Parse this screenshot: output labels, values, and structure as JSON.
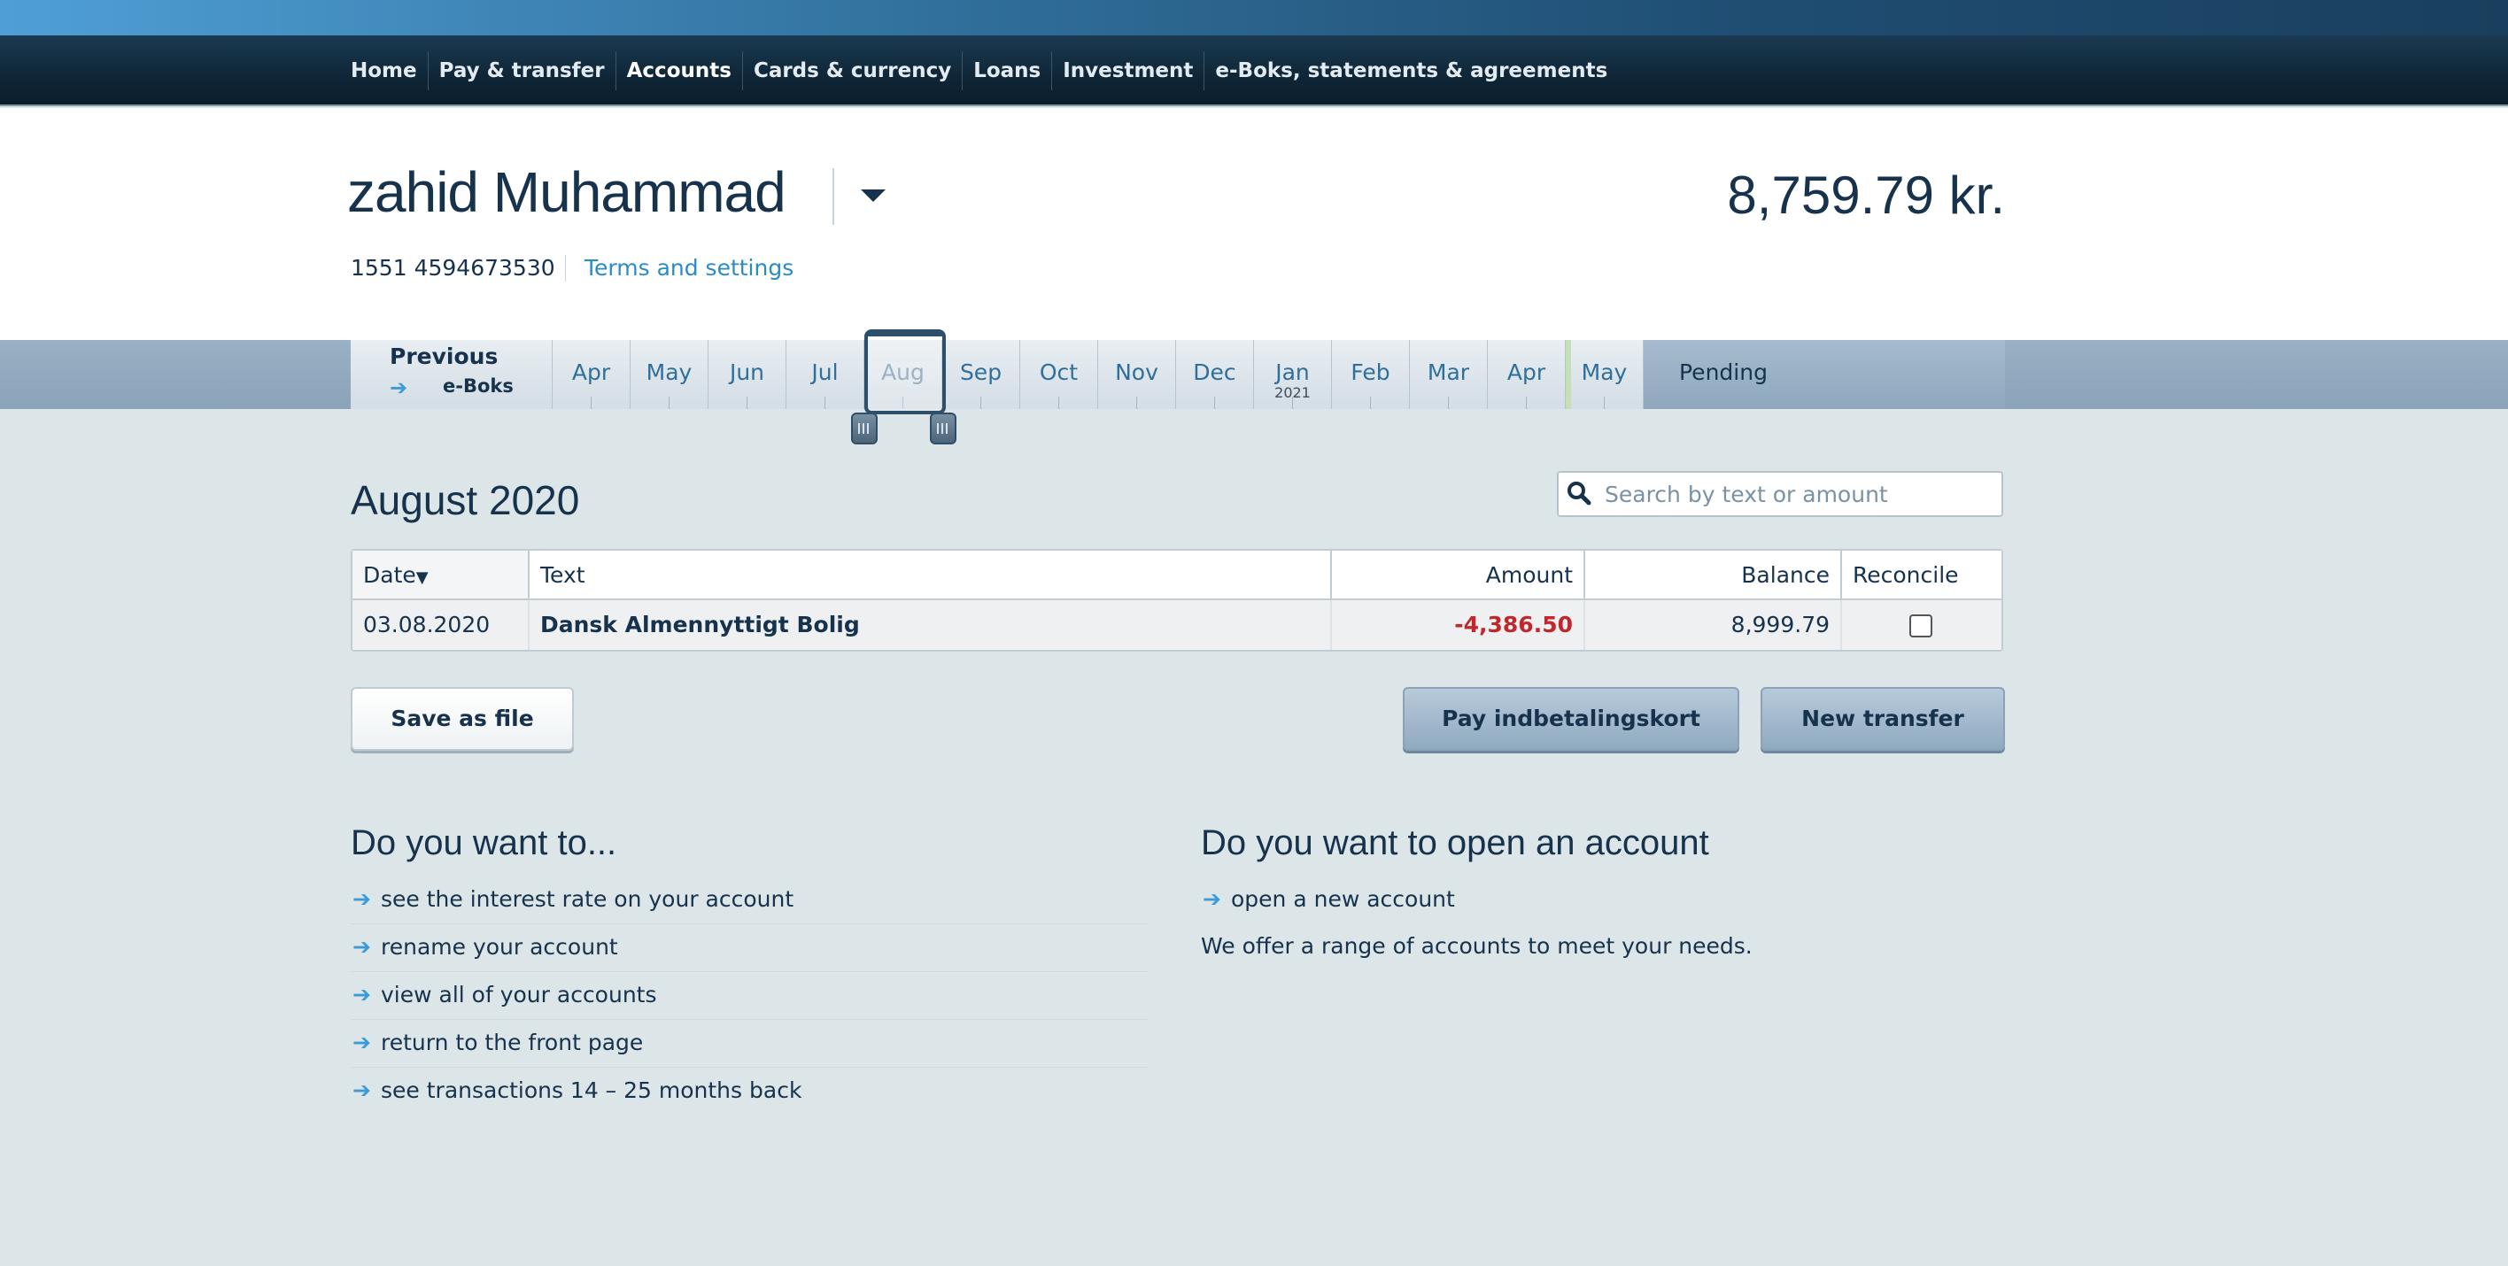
{
  "nav": {
    "items": [
      {
        "label": "Home"
      },
      {
        "label": "Pay & transfer"
      },
      {
        "label": "Accounts"
      },
      {
        "label": "Cards & currency"
      },
      {
        "label": "Loans"
      },
      {
        "label": "Investment"
      },
      {
        "label": "e-Boks, statements & agreements"
      }
    ],
    "active": "Accounts"
  },
  "account": {
    "name": "zahid Muhammad",
    "balance": "8,759.79 kr.",
    "number": "1551 4594673530",
    "terms_link": "Terms and settings"
  },
  "month_bar": {
    "previous_label": "Previous",
    "previous_sub": "e-Boks",
    "months": [
      {
        "label": "Apr",
        "year": ""
      },
      {
        "label": "May",
        "year": ""
      },
      {
        "label": "Jun",
        "year": ""
      },
      {
        "label": "Jul",
        "year": ""
      },
      {
        "label": "Aug",
        "year": ""
      },
      {
        "label": "Sep",
        "year": ""
      },
      {
        "label": "Oct",
        "year": ""
      },
      {
        "label": "Nov",
        "year": ""
      },
      {
        "label": "Dec",
        "year": ""
      },
      {
        "label": "Jan",
        "year": "2021"
      },
      {
        "label": "Feb",
        "year": ""
      },
      {
        "label": "Mar",
        "year": ""
      },
      {
        "label": "Apr",
        "year": ""
      },
      {
        "label": "May",
        "year": ""
      }
    ],
    "selected": "Aug",
    "pending_label": "Pending"
  },
  "period": {
    "title": "August 2020"
  },
  "search": {
    "placeholder": "Search by text or amount",
    "value": ""
  },
  "table": {
    "headers": {
      "date": "Date",
      "text": "Text",
      "amount": "Amount",
      "balance": "Balance",
      "reconcile": "Reconcile"
    },
    "sort_indicator": "▼",
    "rows": [
      {
        "date": "03.08.2020",
        "text": "Dansk Almennyttigt Bolig",
        "amount": "-4,386.50",
        "balance": "8,999.79",
        "reconciled": false
      }
    ]
  },
  "buttons": {
    "save_file": "Save as file",
    "pay_card": "Pay indbetalingskort",
    "new_transfer": "New transfer"
  },
  "do_you_want": {
    "title": "Do you want to...",
    "links": [
      "see the interest rate on your account",
      "rename your account",
      "view all of your accounts",
      "return to the front page",
      "see transactions 14 – 25 months back"
    ]
  },
  "open_account": {
    "title": "Do you want to open an account",
    "link": "open a new account",
    "text": "We offer a range of accounts to meet your needs."
  },
  "colors": {
    "navy": "#17324d",
    "link_blue": "#2b8cc4",
    "negative": "#c0282d",
    "nav_bg": "#0f2637"
  }
}
